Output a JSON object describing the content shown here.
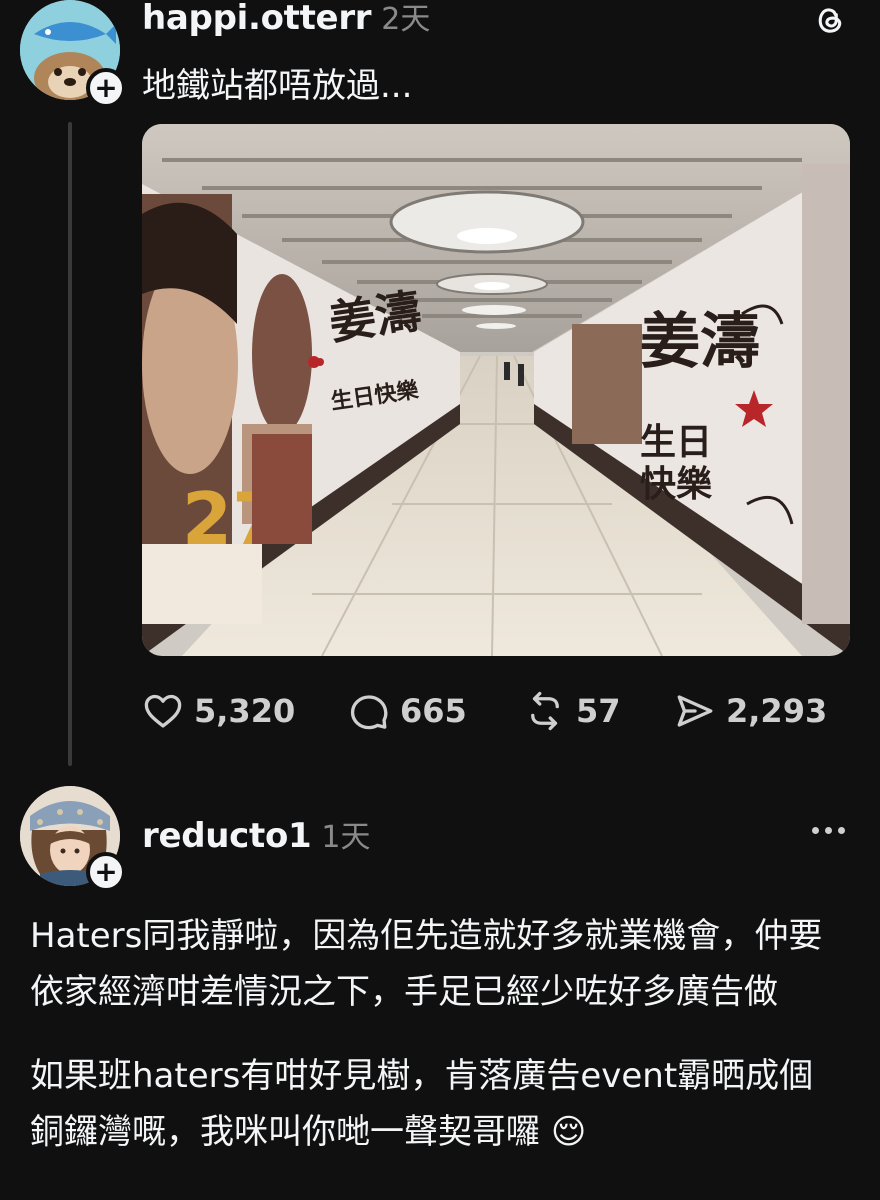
{
  "post": {
    "username": "happi.otterr",
    "time_ago": "2天",
    "text": "地鐵站都唔放過...",
    "image_banner_left": "姜濤\n生日快樂",
    "image_banner_right": "姜濤\n生日快樂",
    "image_cake_number": "27",
    "actions": {
      "likes": "5,320",
      "comments": "665",
      "reposts": "57",
      "shares": "2,293"
    }
  },
  "reply": {
    "username": "reducto1",
    "time_ago": "1天",
    "paragraph1": "Haters同我靜啦，因為佢先造就好多就業機會，仲要依家經濟咁差情況之下，手足已經少咗好多廣告做",
    "paragraph2": "如果班haters有咁好見樹，肯落廣告event霸晒成個銅鑼灣嘅，我咪叫你哋一聲契哥囉",
    "emoji": "😌"
  },
  "colors": {
    "background": "#101010",
    "text": "#f3f5f7",
    "muted": "#8a8a8a",
    "thread_line": "#3a3a3a"
  },
  "icons": {
    "threads_logo": "threads-logo-icon",
    "like": "heart-icon",
    "comment": "comment-bubble-icon",
    "repost": "repost-icon",
    "share": "send-icon",
    "more": "more-dots-icon",
    "follow": "plus-icon"
  }
}
